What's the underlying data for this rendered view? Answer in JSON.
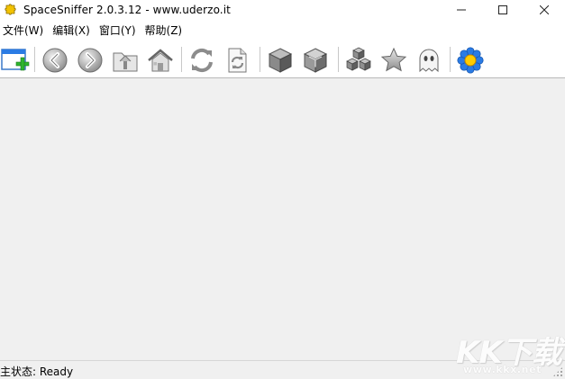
{
  "window": {
    "title": "SpaceSniffer 2.0.3.12 - www.uderzo.it",
    "app_icon": "puzzle-piece-icon",
    "controls": [
      "minimize-icon",
      "maximize-icon",
      "close-icon"
    ]
  },
  "menu": {
    "items": [
      {
        "label": "文件(W)"
      },
      {
        "label": "编辑(X)"
      },
      {
        "label": "窗口(Y)"
      },
      {
        "label": "帮助(Z)"
      }
    ]
  },
  "toolbar": {
    "buttons": [
      {
        "name": "new-scan-button",
        "icon": "new-window-plus-icon"
      },
      {
        "name": "back-button",
        "icon": "arrow-left-circle-icon"
      },
      {
        "name": "forward-button",
        "icon": "arrow-right-circle-icon"
      },
      {
        "name": "up-folder-button",
        "icon": "folder-up-icon"
      },
      {
        "name": "home-button",
        "icon": "house-icon"
      },
      {
        "name": "refresh-button",
        "icon": "refresh-arrows-icon"
      },
      {
        "name": "refresh-document-button",
        "icon": "refresh-document-icon"
      },
      {
        "name": "zoom-in-cube-button",
        "icon": "gray-cube-icon"
      },
      {
        "name": "zoom-out-cube-button",
        "icon": "gray-cube-outline-icon"
      },
      {
        "name": "cubes-button",
        "icon": "stacked-cubes-icon"
      },
      {
        "name": "favorites-button",
        "icon": "star-icon"
      },
      {
        "name": "ghost-button",
        "icon": "ghost-icon"
      },
      {
        "name": "options-button",
        "icon": "blue-flower-icon"
      }
    ]
  },
  "status": {
    "text": "主状态: Ready"
  },
  "watermark": {
    "big": "KK下载",
    "small": "www.kkx.net"
  },
  "colors": {
    "workspace_bg": "#f0f0f0",
    "accent_blue": "#2a7be4",
    "plus_green": "#2fb52f"
  }
}
